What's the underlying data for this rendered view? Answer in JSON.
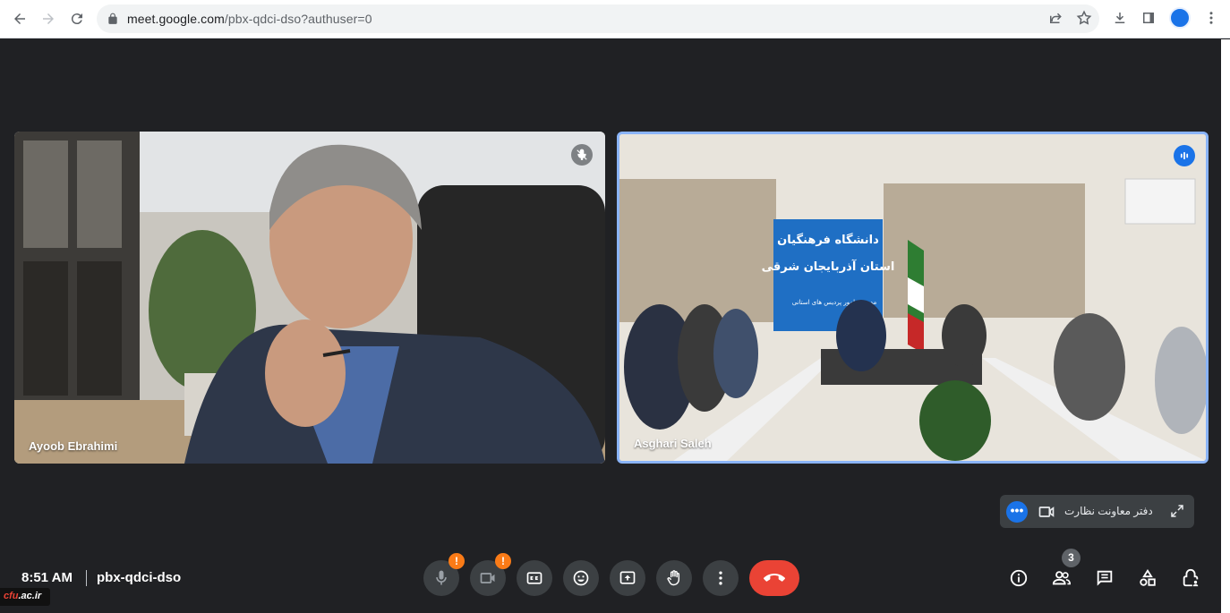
{
  "browser": {
    "url_host": "meet.google.com",
    "url_path": "/pbx-qdci-dso?authuser=0"
  },
  "tiles": [
    {
      "name": "Ayoob Ebrahimi",
      "muted": true
    },
    {
      "name": "Asghari Saleh",
      "speaking": true
    }
  ],
  "banner": {
    "line1": "دانشگاه فرهنگیان",
    "line2": "استان آذربایجان شرقی",
    "line3": "مدیریت امور پردیس های استانی"
  },
  "self_view": {
    "label": "دفتر معاونت نظارت",
    "more_glyph": "•••"
  },
  "meeting": {
    "time": "8:51 AM",
    "code": "pbx-qdci-dso"
  },
  "controls": {
    "mic_alert": "!",
    "cam_alert": "!",
    "people_count": "3"
  },
  "watermark": {
    "prefix": "cfu",
    "suffix": ".ac.ir"
  },
  "colors": {
    "accent": "#1a73e8",
    "end_call": "#ea4335",
    "alert": "#fa7b17",
    "bg": "#202124",
    "active_border": "#8ab4f8"
  }
}
